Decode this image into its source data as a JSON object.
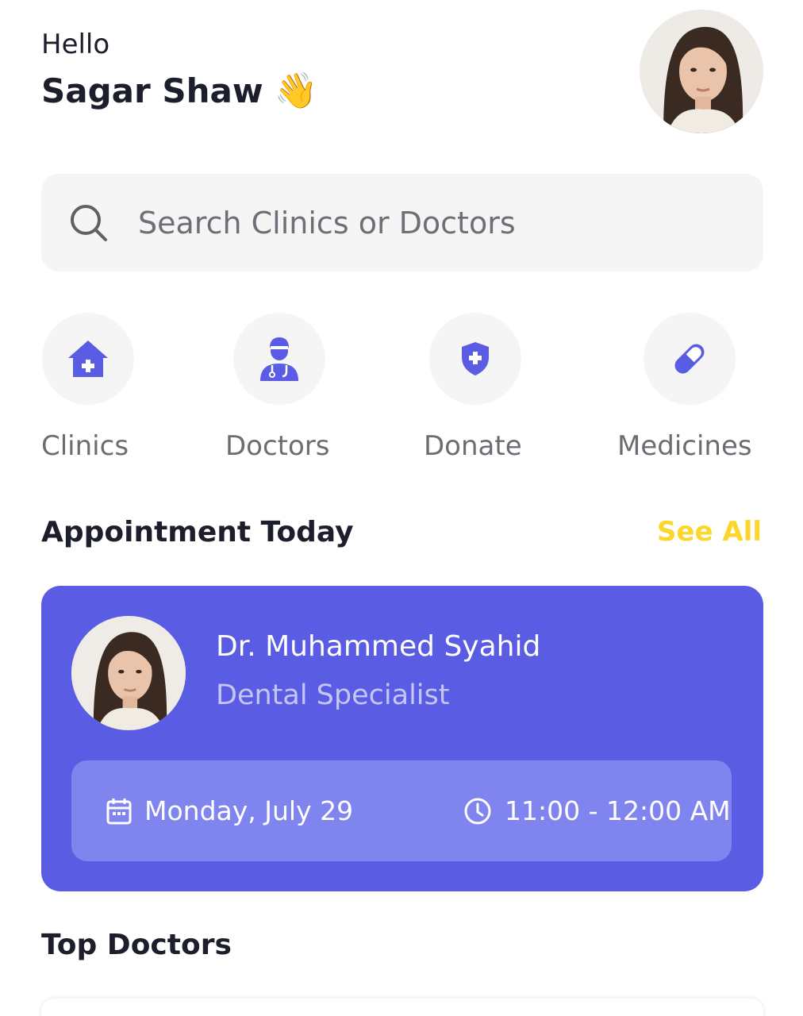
{
  "greeting": {
    "hello": "Hello",
    "name": "Sagar Shaw",
    "emoji": "👋"
  },
  "profile": {
    "avatar_icon": "user-avatar-photo"
  },
  "search": {
    "placeholder": "Search Clinics or Doctors",
    "icon": "search-icon"
  },
  "categories": [
    {
      "label": "Clinics",
      "icon": "clinic-house-icon"
    },
    {
      "label": "Doctors",
      "icon": "doctor-icon"
    },
    {
      "label": "Donate",
      "icon": "shield-plus-icon"
    },
    {
      "label": "Medicines",
      "icon": "pill-icon"
    }
  ],
  "appointment_section": {
    "title": "Appointment Today",
    "see_all": "See All"
  },
  "appointment": {
    "doctor_name": "Dr. Muhammed Syahid",
    "specialty": "Dental Specialist",
    "date": "Monday, July 29",
    "time": "11:00 - 12:00 AM"
  },
  "top_doctors": {
    "title": "Top Doctors"
  },
  "colors": {
    "accent": "#5a5de3",
    "accent_light": "#8084ee",
    "see_all": "#fcd62a",
    "icon": "#5a5de3",
    "category_bg": "#f5f5f5"
  }
}
